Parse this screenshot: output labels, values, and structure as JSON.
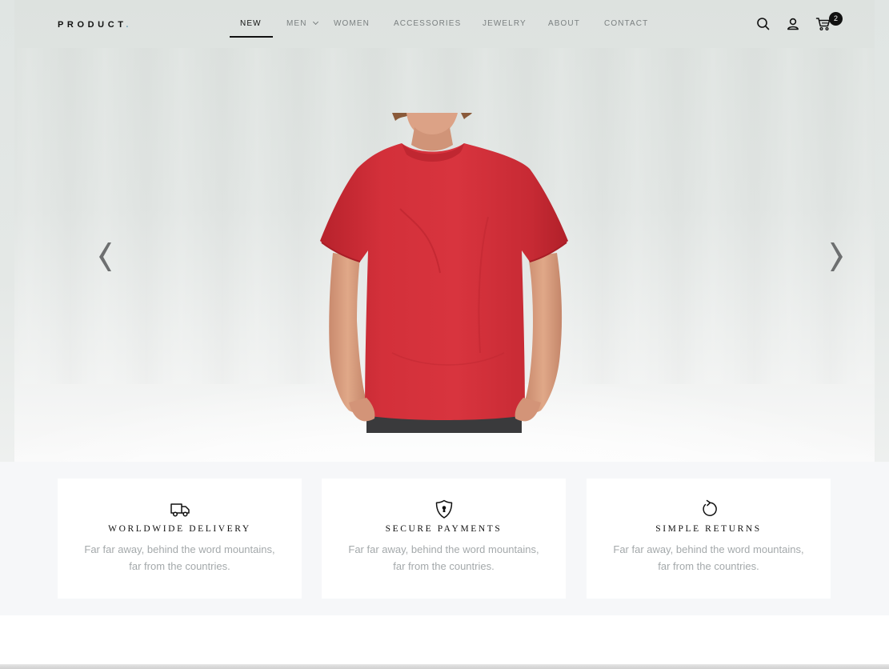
{
  "header": {
    "logo_text": "PRODUCT",
    "logo_dot": ".",
    "nav": [
      {
        "label": "NEW"
      },
      {
        "label": "MEN"
      },
      {
        "label": "WOMEN"
      },
      {
        "label": "ACCESSORIES"
      },
      {
        "label": "JEWELRY"
      },
      {
        "label": "ABOUT"
      },
      {
        "label": "CONTACT"
      }
    ],
    "active_nav": "NEW",
    "cart_count": "2",
    "icons": [
      "search-icon",
      "user-icon",
      "cart-icon"
    ]
  },
  "hero": {
    "product_image": "red-tshirt-model",
    "prev_icon": "chevron-left-icon",
    "next_icon": "chevron-right-icon"
  },
  "features": [
    {
      "icon": "truck-icon",
      "title": "WORLDWIDE DELIVERY",
      "line1": "Far far away, behind the word mountains,",
      "line2": "far from the countries."
    },
    {
      "icon": "shield-lock-icon",
      "title": "SECURE PAYMENTS",
      "line1": "Far far away, behind the word mountains,",
      "line2": "far from the countries."
    },
    {
      "icon": "return-icon",
      "title": "SIMPLE RETURNS",
      "line1": "Far far away, behind the word mountains,",
      "line2": "far from the countries."
    }
  ],
  "colors": {
    "accent_dot": "#6aa0b8",
    "shirt": "#d3303a",
    "text_dark": "#111111",
    "text_muted": "#a4a9ab"
  }
}
